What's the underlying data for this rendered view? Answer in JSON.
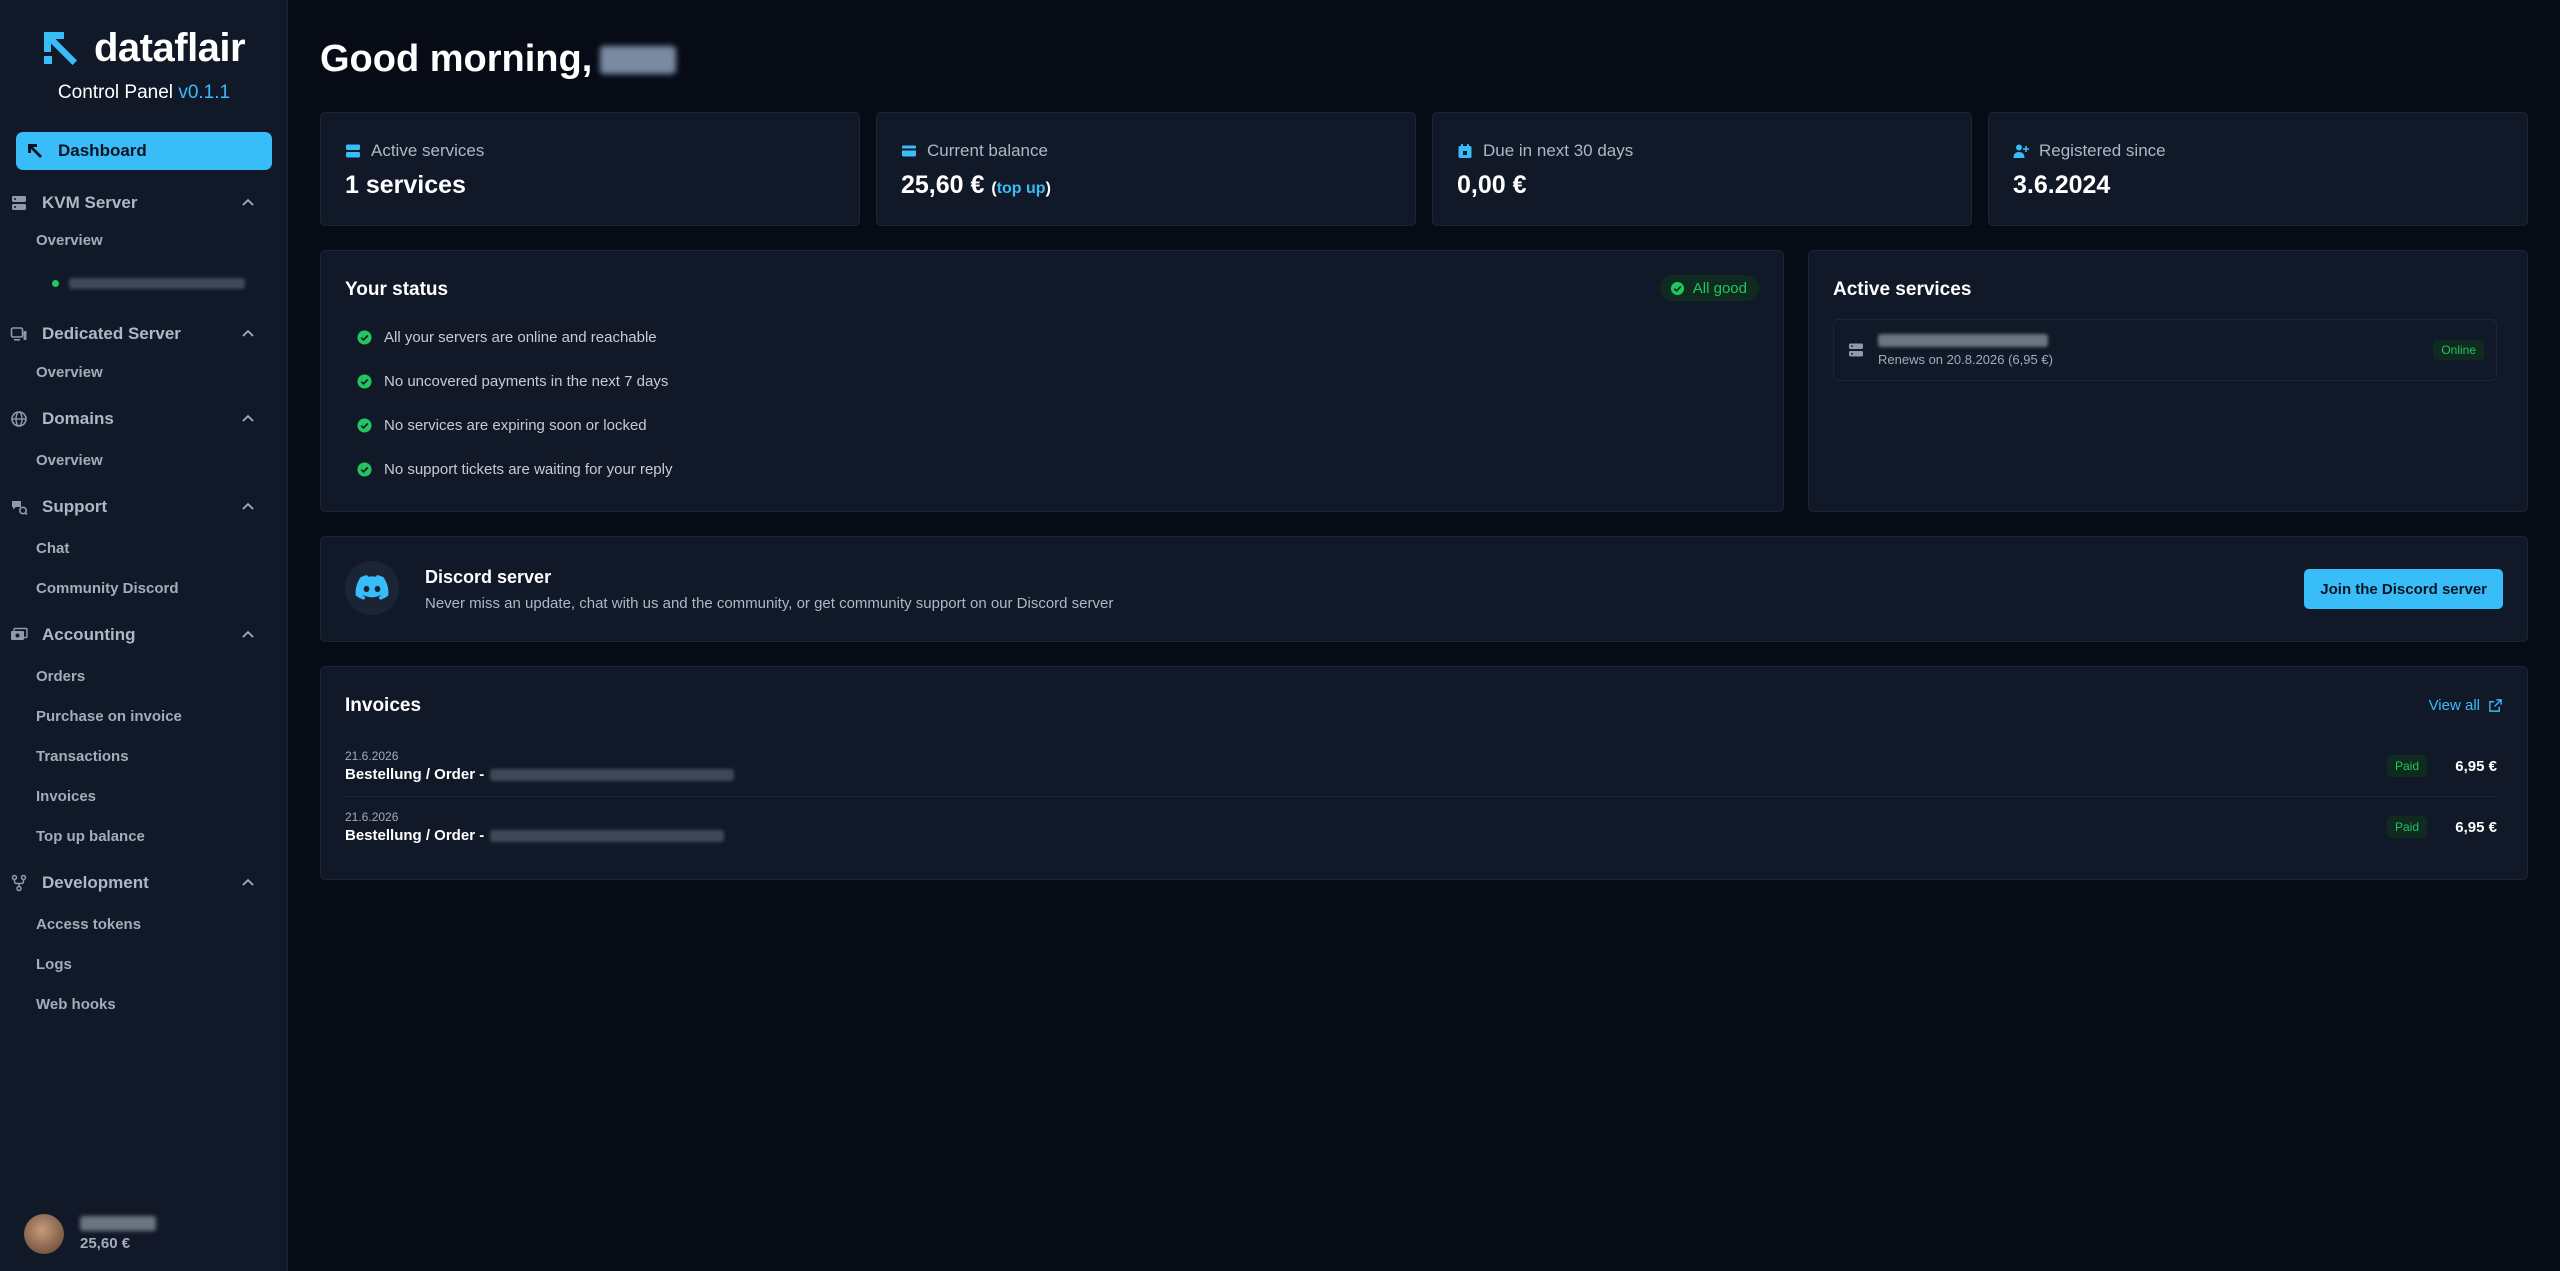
{
  "brand": {
    "name": "dataflair",
    "subtitle": "Control Panel",
    "version": "v0.1.1"
  },
  "sidebar": {
    "active_item": "Dashboard",
    "groups": [
      {
        "label": "KVM Server",
        "items": [
          "Overview"
        ]
      },
      {
        "label": "Dedicated Server",
        "items": [
          "Overview"
        ]
      },
      {
        "label": "Domains",
        "items": [
          "Overview"
        ]
      },
      {
        "label": "Support",
        "items": [
          "Chat",
          "Community Discord"
        ]
      },
      {
        "label": "Accounting",
        "items": [
          "Orders",
          "Purchase on invoice",
          "Transactions",
          "Invoices",
          "Top up balance"
        ]
      },
      {
        "label": "Development",
        "items": [
          "Access tokens",
          "Logs",
          "Web hooks"
        ]
      }
    ],
    "user_balance": "25,60 €"
  },
  "header": {
    "greeting": "Good morning,"
  },
  "stats": [
    {
      "label": "Active services",
      "value": "1 services",
      "icon": "server-icon"
    },
    {
      "label": "Current balance",
      "value": "25,60 €",
      "link": "top up",
      "icon": "wallet-icon"
    },
    {
      "label": "Due in next 30 days",
      "value": "0,00 €",
      "icon": "calendar-icon"
    },
    {
      "label": "Registered since",
      "value": "3.6.2024",
      "icon": "user-plus-icon"
    }
  ],
  "status": {
    "title": "Your status",
    "badge": "All good",
    "items": [
      "All your servers are online and reachable",
      "No uncovered payments in the next 7 days",
      "No services are expiring soon or locked",
      "No support tickets are waiting for your reply"
    ]
  },
  "active_services": {
    "title": "Active services",
    "service_renew": "Renews on 20.8.2026 (6,95 €)",
    "service_status": "Online"
  },
  "discord": {
    "title": "Discord server",
    "description": "Never miss an update, chat with us and the community, or get community support on our Discord server",
    "button": "Join the Discord server"
  },
  "invoices": {
    "title": "Invoices",
    "view_all": "View all",
    "rows": [
      {
        "date": "21.6.2026",
        "title": "Bestellung / Order -",
        "status": "Paid",
        "amount": "6,95 €"
      },
      {
        "date": "21.6.2026",
        "title": "Bestellung / Order -",
        "status": "Paid",
        "amount": "6,95 €"
      }
    ]
  },
  "colors": {
    "background": "#060b16",
    "panel": "#111827",
    "accent": "#38bdf8",
    "success": "#22c55e"
  }
}
